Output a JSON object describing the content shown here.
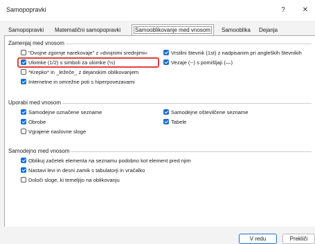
{
  "window": {
    "title": "Samopopravki",
    "help_label": "?",
    "close_label": "✕"
  },
  "tabs": [
    {
      "label": "Samopopravki"
    },
    {
      "label": "Matematični samopopravki"
    },
    {
      "label": "Samooblikovanje med vnosom"
    },
    {
      "label": "Samooblika"
    },
    {
      "label": "Dejanja"
    }
  ],
  "replace_group": {
    "title": "Zamenjaj med vnosom",
    "options": [
      {
        "label": "\"Dvojne zgornje narekovaje\" z »dvojnimi srednjimi«",
        "checked": false
      },
      {
        "label": "Vrstilni števnik (1st) z nadpisanim pri angleških števnikih",
        "checked": true
      },
      {
        "label": "Ulomke (1/2) s simboli za ulomke (½)",
        "checked": true
      },
      {
        "label": "Vezaje (--) s pomišljaji (—)",
        "checked": true
      },
      {
        "label": "*Krepko* in _ležeče_ z dejanskim oblikovanjem",
        "checked": false
      },
      {
        "label": "Internetne in omrežne poti s hiperpovezavami",
        "checked": true
      }
    ]
  },
  "apply_group": {
    "title": "Uporabi med vnosom",
    "options": [
      {
        "label": "Samodejne označene sezname",
        "checked": true
      },
      {
        "label": "Samodejne oštevilčene sezname",
        "checked": true
      },
      {
        "label": "Obrobe",
        "checked": true
      },
      {
        "label": "Tabele",
        "checked": true
      },
      {
        "label": "Vgrajene naslovne sloge",
        "checked": false
      }
    ]
  },
  "auto_group": {
    "title": "Samodejno med vnosom",
    "options": [
      {
        "label": "Oblikuj začetek elementa na seznamu podobno kot element pred njim",
        "checked": true
      },
      {
        "label": "Nastavi levi in desni zamik s tabulatorji in vračalko",
        "checked": true
      },
      {
        "label": "Določi sloge, ki temeljijo na oblikovanju",
        "checked": false
      }
    ]
  },
  "footer": {
    "ok_label": "V redu",
    "cancel_label": "Prekliči"
  },
  "colors": {
    "accent": "#1a6fd1",
    "highlight": "#e0403a"
  }
}
